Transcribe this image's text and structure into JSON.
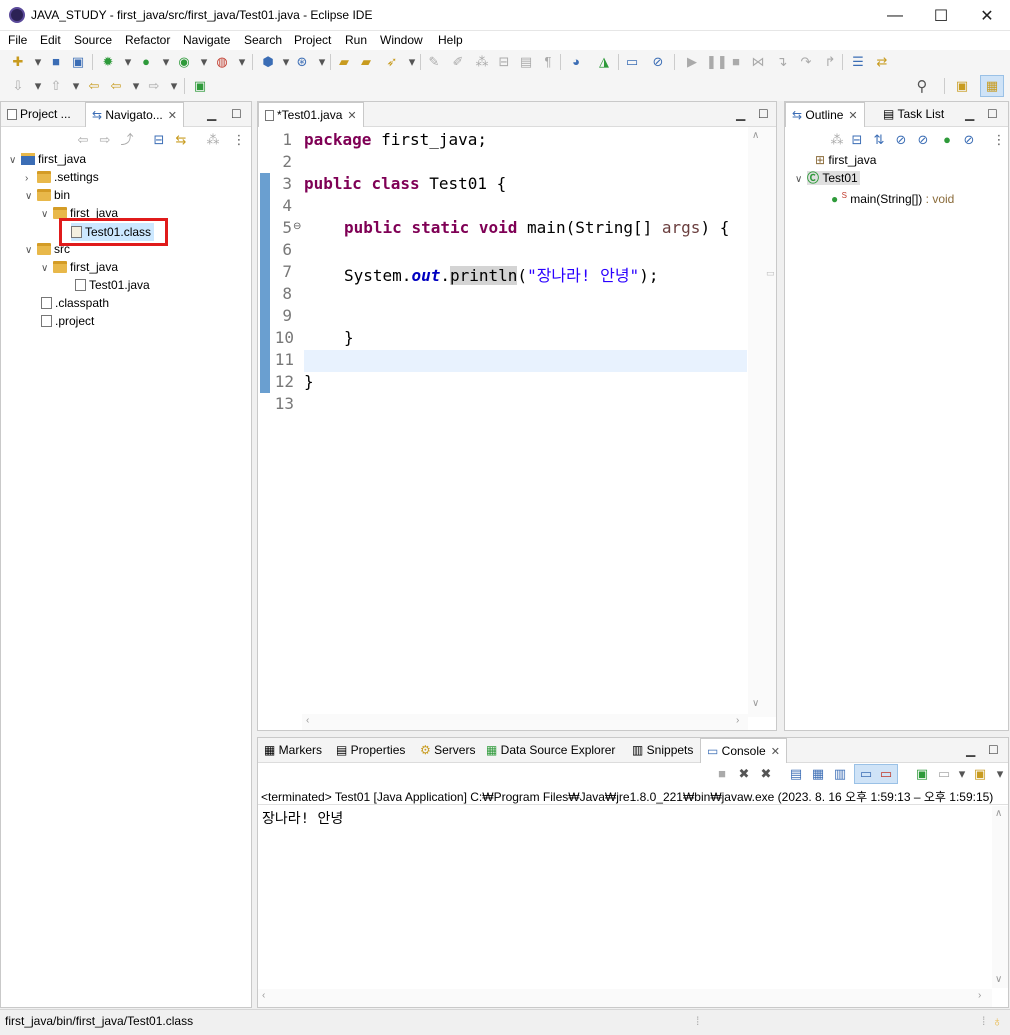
{
  "window": {
    "title": "JAVA_STUDY - first_java/src/first_java/Test01.java - Eclipse IDE",
    "min": "—",
    "max": "☐",
    "close": "✕"
  },
  "menu": [
    "File",
    "Edit",
    "Source",
    "Refactor",
    "Navigate",
    "Search",
    "Project",
    "Run",
    "Window",
    "Help"
  ],
  "left_panel": {
    "tabs": [
      {
        "label": "Project ..."
      },
      {
        "label": "Navigato..."
      }
    ],
    "tree": [
      {
        "label": "first_java",
        "icon": "project-icon"
      },
      {
        "label": ".settings",
        "icon": "folder-icon"
      },
      {
        "label": "bin",
        "icon": "folder-icon"
      },
      {
        "label": "first_java",
        "icon": "folder-icon"
      },
      {
        "label": "Test01.class",
        "icon": "class-file-icon"
      },
      {
        "label": "src",
        "icon": "folder-icon"
      },
      {
        "label": "first_java",
        "icon": "folder-icon"
      },
      {
        "label": "Test01.java",
        "icon": "java-file-icon"
      },
      {
        "label": ".classpath",
        "icon": "xml-file-icon"
      },
      {
        "label": ".project",
        "icon": "xml-file-icon"
      }
    ]
  },
  "editor": {
    "tab": "*Test01.java",
    "line_numbers": [
      "1",
      "2",
      "3",
      "4",
      "5",
      "6",
      "7",
      "8",
      "9",
      "10",
      "11",
      "12",
      "13"
    ],
    "code": {
      "l1_kw": "package",
      "l1_rest": " first_java;",
      "l3_kw1": "public",
      "l3_kw2": "class",
      "l3_rest": " Test01 {",
      "l5_kw1": "public",
      "l5_kw2": "static",
      "l5_kw3": "void",
      "l5_main": " main(String[] ",
      "l5_args": "args",
      "l5_end": ") {",
      "l7_sys": "System.",
      "l7_out": "out",
      "l7_dot": ".",
      "l7_println": "println",
      "l7_open": "(",
      "l7_str": "\"장나라! 안녕\"",
      "l7_end": ");",
      "l10": "}",
      "l12": "}"
    }
  },
  "outline": {
    "tabs": [
      {
        "label": "Outline"
      },
      {
        "label": "Task List"
      }
    ],
    "items": [
      {
        "label": "first_java"
      },
      {
        "label": "Test01"
      },
      {
        "label": "main(String[])",
        "type": " : void"
      }
    ]
  },
  "bottom": {
    "tabs": [
      {
        "label": "Markers"
      },
      {
        "label": "Properties"
      },
      {
        "label": "Servers"
      },
      {
        "label": "Data Source Explorer"
      },
      {
        "label": "Snippets"
      },
      {
        "label": "Console"
      }
    ],
    "terminated": "<terminated> Test01 [Java Application] C:₩Program Files₩Java₩jre1.8.0_221₩bin₩javaw.exe  (2023. 8. 16 오후 1:59:13 – 오후 1:59:15)",
    "output": "장나라! 안녕"
  },
  "status": {
    "path": "first_java/bin/first_java/Test01.class"
  },
  "colors": {
    "highlight_box": "#e01b1b",
    "keyword": "#7f0055",
    "string": "#2a00ff"
  }
}
